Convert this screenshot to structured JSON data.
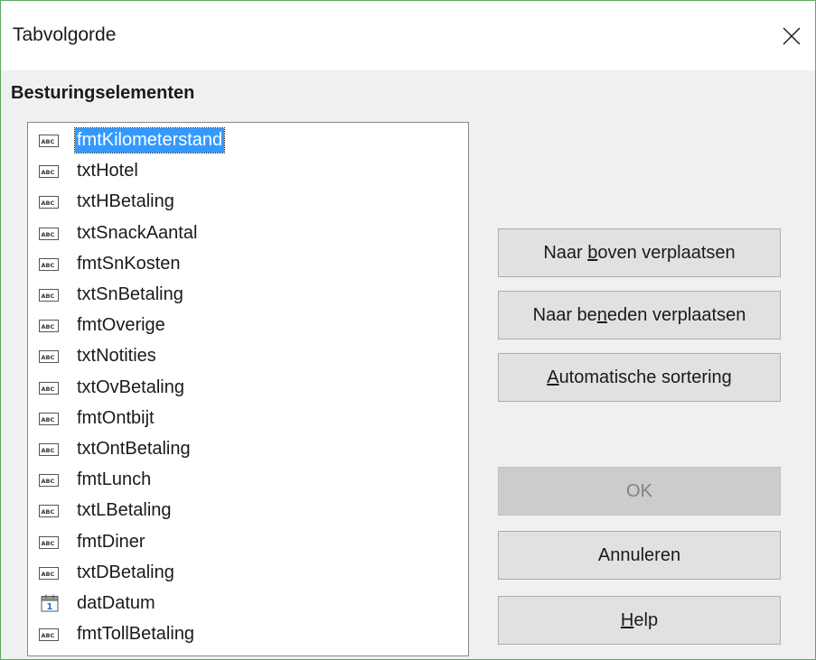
{
  "window": {
    "title": "Tabvolgorde",
    "close_icon": "close-icon"
  },
  "section": {
    "label": "Besturingselementen"
  },
  "controls": [
    {
      "name": "fmtKilometerstand",
      "icon": "text-field-icon",
      "selected": true
    },
    {
      "name": "txtHotel",
      "icon": "text-field-icon"
    },
    {
      "name": "txtHBetaling",
      "icon": "text-field-icon"
    },
    {
      "name": "txtSnackAantal",
      "icon": "text-field-icon"
    },
    {
      "name": "fmtSnKosten",
      "icon": "text-field-icon"
    },
    {
      "name": "txtSnBetaling",
      "icon": "text-field-icon"
    },
    {
      "name": "fmtOverige",
      "icon": "text-field-icon"
    },
    {
      "name": "txtNotities",
      "icon": "text-field-icon"
    },
    {
      "name": "txtOvBetaling",
      "icon": "text-field-icon"
    },
    {
      "name": "fmtOntbijt",
      "icon": "text-field-icon"
    },
    {
      "name": "txtOntBetaling",
      "icon": "text-field-icon"
    },
    {
      "name": "fmtLunch",
      "icon": "text-field-icon"
    },
    {
      "name": "txtLBetaling",
      "icon": "text-field-icon"
    },
    {
      "name": "fmtDiner",
      "icon": "text-field-icon"
    },
    {
      "name": "txtDBetaling",
      "icon": "text-field-icon"
    },
    {
      "name": "datDatum",
      "icon": "date-field-icon"
    },
    {
      "name": "fmtTollBetaling",
      "icon": "text-field-icon"
    }
  ],
  "buttons": {
    "move_up": {
      "pre": "Naar ",
      "accel": "b",
      "post": "oven verplaatsen"
    },
    "move_down": {
      "pre": "Naar be",
      "accel": "n",
      "post": "eden verplaatsen"
    },
    "auto_sort": {
      "pre": "",
      "accel": "A",
      "post": "utomatische sortering"
    },
    "ok": {
      "label": "OK",
      "enabled": false
    },
    "cancel": {
      "label": "Annuleren"
    },
    "help": {
      "pre": "",
      "accel": "H",
      "post": "elp"
    }
  },
  "colors": {
    "selection": "#3399ff",
    "window_border": "#5fa85f"
  }
}
